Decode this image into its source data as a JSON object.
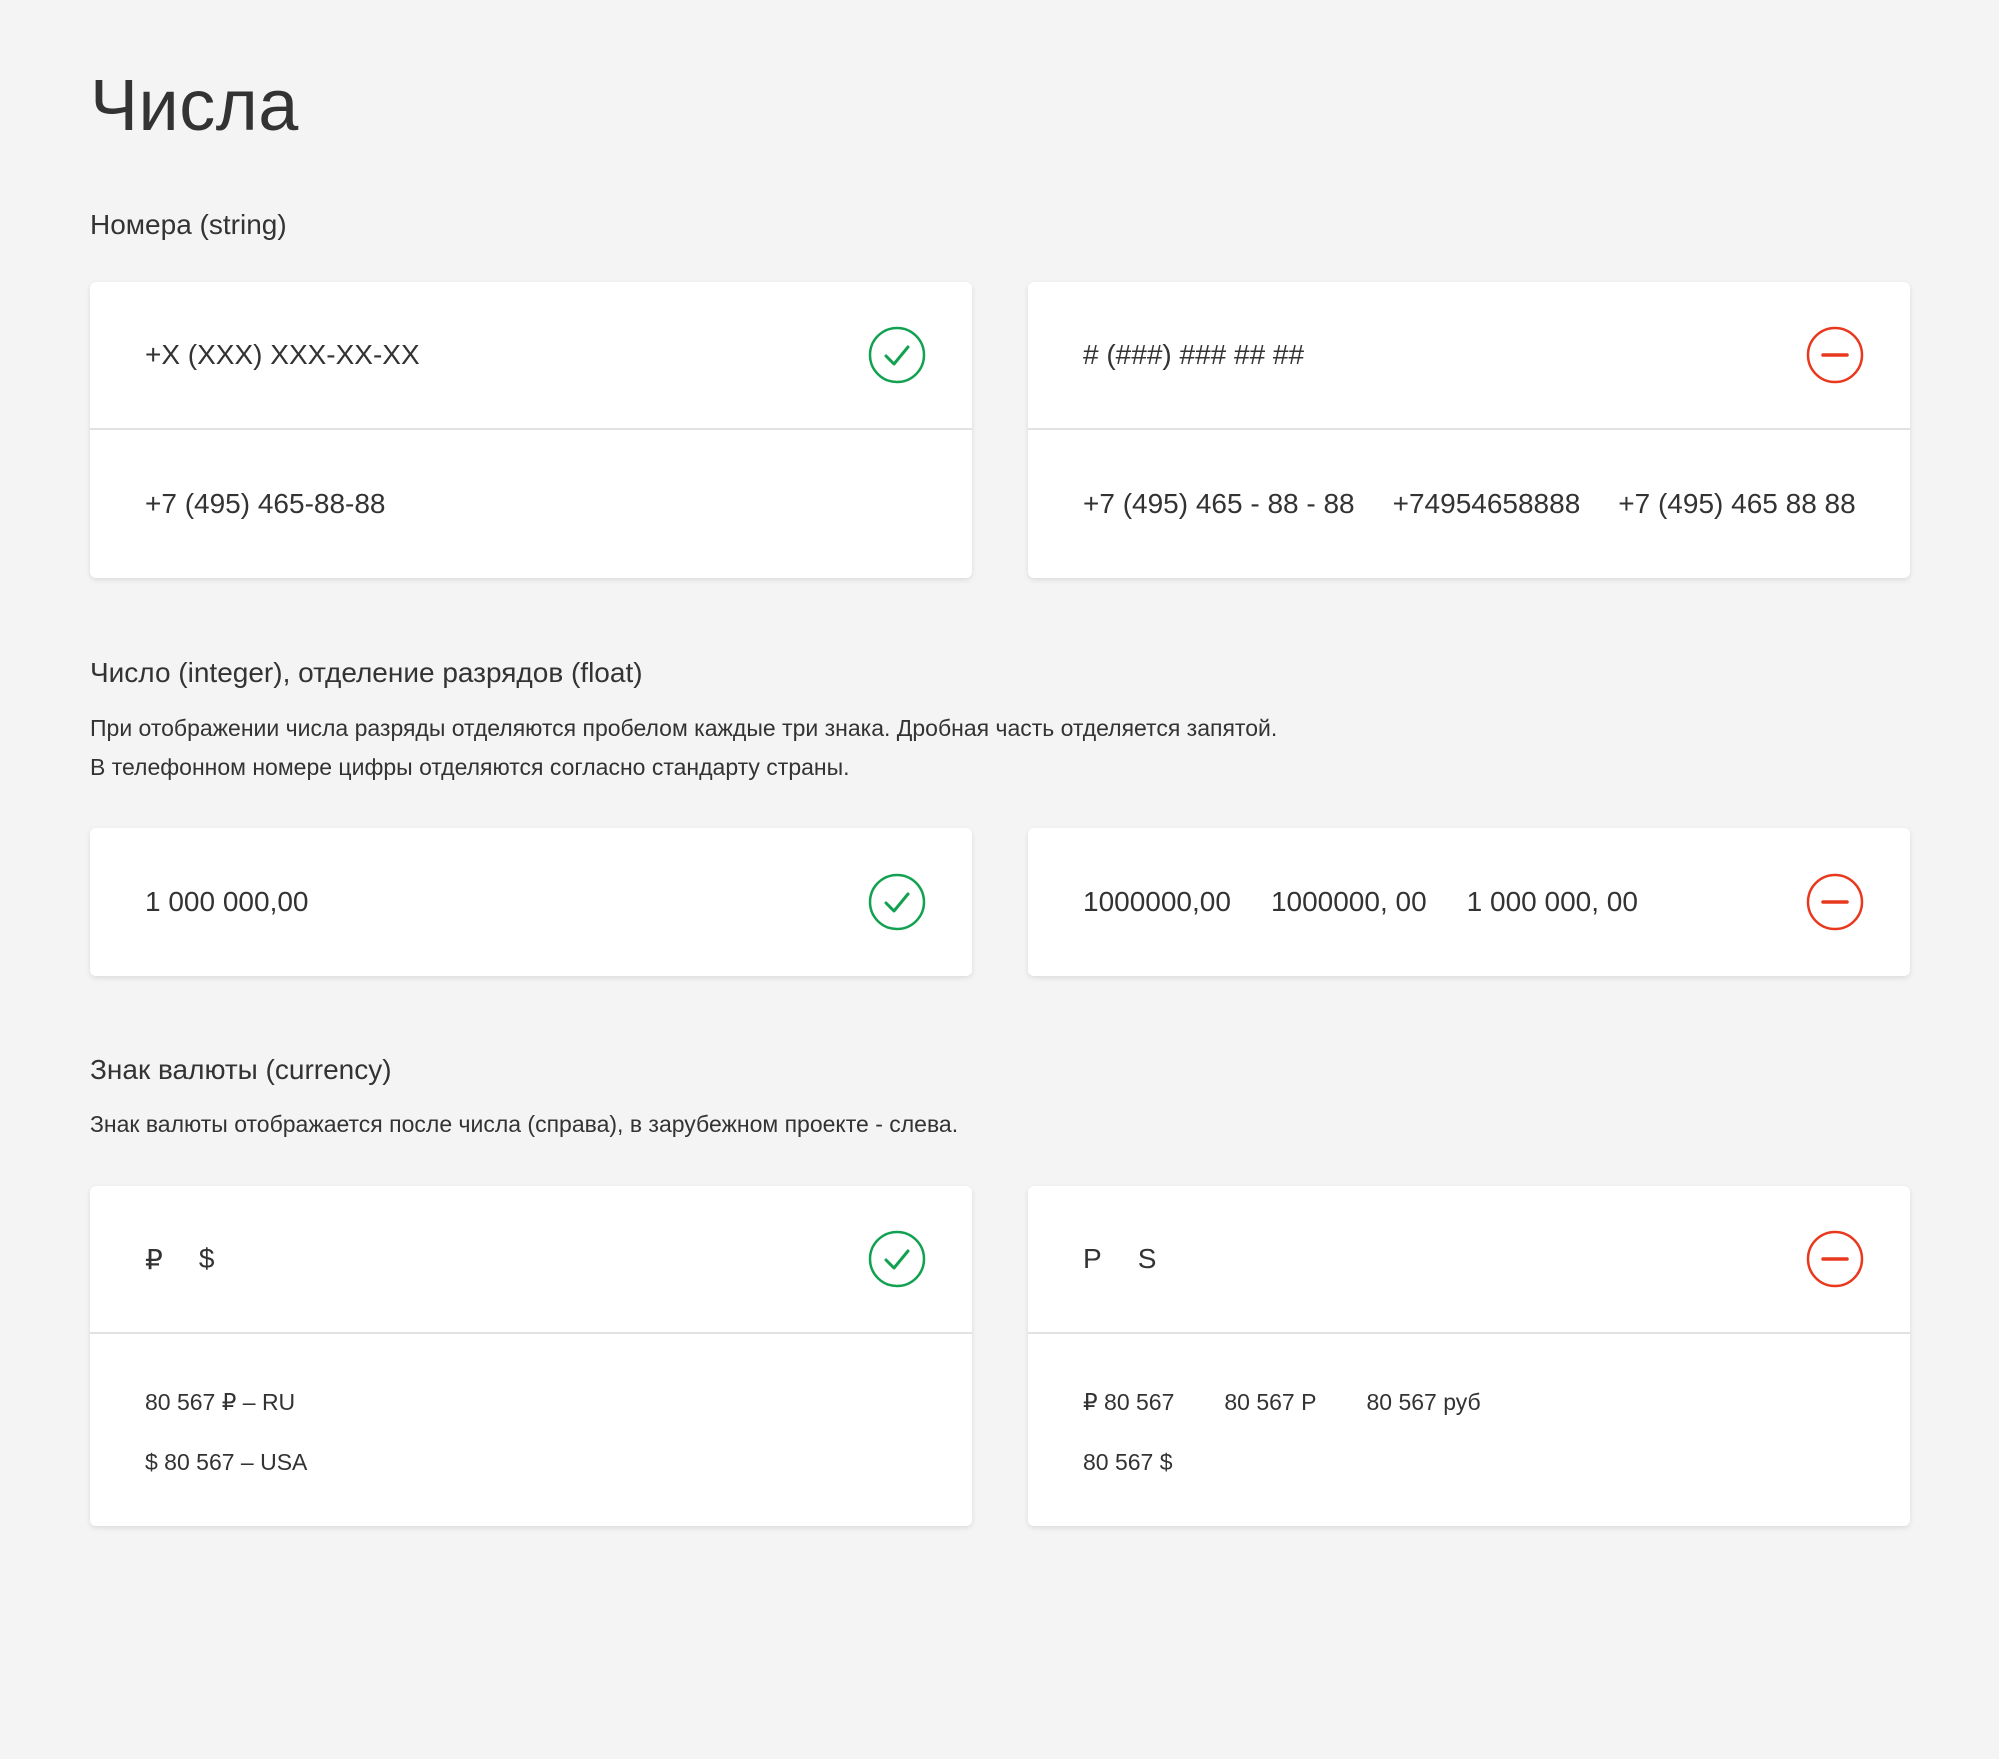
{
  "page": {
    "title": "Числа"
  },
  "colors": {
    "ok": "#12a150",
    "bad": "#e8391f",
    "background": "#f4f4f4",
    "card": "#ffffff"
  },
  "phones": {
    "title": "Номера (string)",
    "good": {
      "status_icon": "check-circle-icon",
      "format": "+X (XXX) XXX-XX-XX",
      "examples": [
        "+7 (495) 465-88-88"
      ]
    },
    "bad": {
      "status_icon": "minus-circle-icon",
      "format": "# (###) ### ## ##",
      "examples": [
        "+7 (495) 465 - 88 - 88",
        "+74954658888",
        "+7 (495) 465 88 88"
      ]
    }
  },
  "numbers": {
    "title": "Число (integer), отделение разрядов (float)",
    "description": [
      "При отображении числа разряды отделяются пробелом каждые три знака. Дробная часть отделяется запятой.",
      "В телефонном номере цифры отделяются согласно стандарту страны."
    ],
    "good": {
      "status_icon": "check-circle-icon",
      "examples": [
        "1 000 000,00"
      ]
    },
    "bad": {
      "status_icon": "minus-circle-icon",
      "examples": [
        "1000000,00",
        "1000000, 00",
        "1 000 000, 00"
      ]
    }
  },
  "currency": {
    "title": "Знак валюты (currency)",
    "description": "Знак валюты отображается после числа (справа), в зарубежном проекте - слева.",
    "good": {
      "status_icon": "check-circle-icon",
      "symbols": [
        "₽",
        "$"
      ],
      "rows": [
        [
          "80 567 ₽ – RU"
        ],
        [
          "$ 80 567 – USA"
        ]
      ]
    },
    "bad": {
      "status_icon": "minus-circle-icon",
      "symbols": [
        "P",
        "S"
      ],
      "rows": [
        [
          "₽ 80 567",
          "80 567 P",
          "80 567 руб"
        ],
        [
          "80 567 $"
        ]
      ]
    }
  }
}
